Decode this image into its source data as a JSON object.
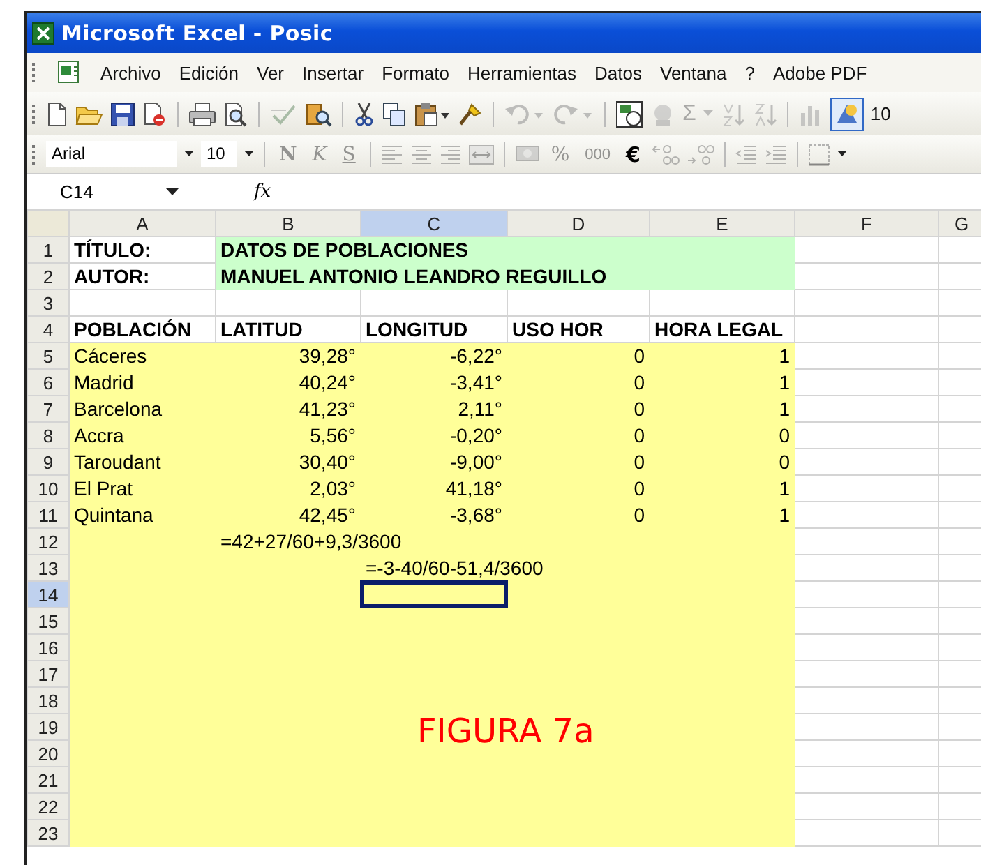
{
  "window": {
    "title": "Microsoft Excel - Posic"
  },
  "menu": [
    "Archivo",
    "Edición",
    "Ver",
    "Insertar",
    "Formato",
    "Herramientas",
    "Datos",
    "Ventana",
    "?",
    "Adobe PDF"
  ],
  "standard_toolbar": {
    "autosum": "Σ",
    "zoom": "10"
  },
  "formatting_toolbar": {
    "font": "Arial",
    "size": "10",
    "bold": "N",
    "italic": "K",
    "underline": "S",
    "percent": "%",
    "thousands": "000",
    "euro": "€"
  },
  "formula_bar": {
    "name_box": "C14",
    "function_label": "fx"
  },
  "sheet": {
    "columns": [
      {
        "label": "A",
        "selected": false
      },
      {
        "label": "B",
        "selected": false
      },
      {
        "label": "C",
        "selected": true
      },
      {
        "label": "D",
        "selected": false
      },
      {
        "label": "E",
        "selected": false
      },
      {
        "label": "F",
        "selected": false
      },
      {
        "label": "G",
        "selected": false
      }
    ],
    "rows": [
      {
        "number": "1",
        "kind": "title",
        "selected": false,
        "cells": [
          "TÍTULO:",
          "DATOS DE POBLACIONES",
          null,
          null,
          null
        ]
      },
      {
        "number": "2",
        "kind": "title",
        "selected": false,
        "cells": [
          "AUTOR:",
          "MANUEL ANTONIO LEANDRO REGUILLO",
          null,
          null,
          null
        ]
      },
      {
        "number": "3",
        "kind": "blank",
        "selected": false
      },
      {
        "number": "4",
        "kind": "header",
        "selected": false,
        "cells": [
          "POBLACIÓN",
          "LATITUD",
          "LONGITUD",
          "USO HOR",
          "HORA LEGAL"
        ]
      },
      {
        "number": "5",
        "kind": "data",
        "selected": false,
        "cells": [
          "Cáceres",
          "39,28°",
          "-6,22°",
          "0",
          "1"
        ]
      },
      {
        "number": "6",
        "kind": "data",
        "selected": false,
        "cells": [
          "Madrid",
          "40,24°",
          "-3,41°",
          "0",
          "1"
        ]
      },
      {
        "number": "7",
        "kind": "data",
        "selected": false,
        "cells": [
          "Barcelona",
          "41,23°",
          "2,11°",
          "0",
          "1"
        ]
      },
      {
        "number": "8",
        "kind": "data",
        "selected": false,
        "cells": [
          "Accra",
          "5,56°",
          "-0,20°",
          "0",
          "0"
        ]
      },
      {
        "number": "9",
        "kind": "data",
        "selected": false,
        "cells": [
          "Taroudant",
          "30,40°",
          "-9,00°",
          "0",
          "0"
        ]
      },
      {
        "number": "10",
        "kind": "data",
        "selected": false,
        "cells": [
          "El Prat",
          "2,03°",
          "41,18°",
          "0",
          "1"
        ]
      },
      {
        "number": "11",
        "kind": "data",
        "selected": false,
        "cells": [
          "Quintana",
          "42,45°",
          "-3,68°",
          "0",
          "1"
        ]
      },
      {
        "number": "12",
        "kind": "formula",
        "selected": false,
        "cells": [
          null,
          "=42+27/60+9,3/3600",
          null,
          null,
          null
        ]
      },
      {
        "number": "13",
        "kind": "formula",
        "selected": false,
        "cells": [
          null,
          null,
          "=-3-40/60-51,4/3600",
          null,
          null
        ]
      },
      {
        "number": "14",
        "kind": "data",
        "selected": true
      },
      {
        "number": "15",
        "kind": "data",
        "selected": false
      },
      {
        "number": "16",
        "kind": "data",
        "selected": false
      },
      {
        "number": "17",
        "kind": "data",
        "selected": false
      },
      {
        "number": "18",
        "kind": "data",
        "selected": false
      },
      {
        "number": "19",
        "kind": "data",
        "selected": false
      },
      {
        "number": "20",
        "kind": "data",
        "selected": false
      },
      {
        "number": "21",
        "kind": "data",
        "selected": false
      },
      {
        "number": "22",
        "kind": "data",
        "selected": false
      },
      {
        "number": "23",
        "kind": "data",
        "selected": false
      }
    ]
  },
  "caption": "FIGURA 7a"
}
